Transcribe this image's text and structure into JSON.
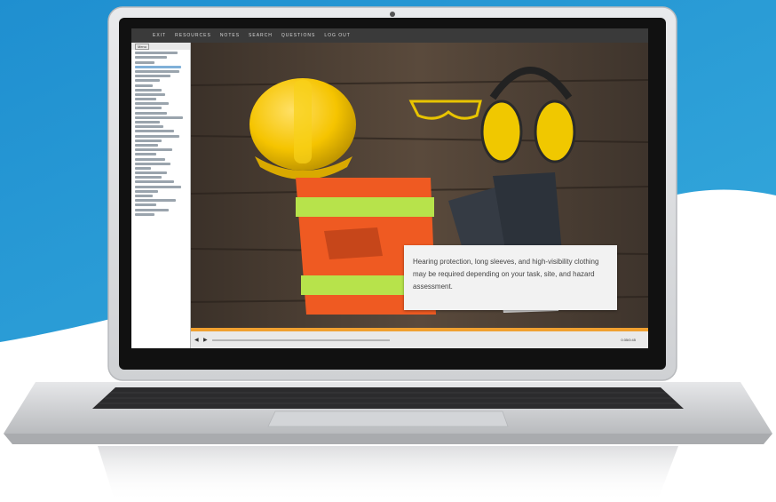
{
  "menu": {
    "items": [
      "EXIT",
      "RESOURCES",
      "NOTES",
      "SEARCH",
      "QUESTIONS",
      "LOG OUT"
    ]
  },
  "sidebar": {
    "tab_label": "Menu"
  },
  "slide": {
    "caption": "Hearing protection, long sleeves, and high-visibility clothing may be required depending on your task, site, and hazard assessment."
  },
  "player": {
    "time": "0:35/0:45"
  },
  "colors": {
    "background_blue": "#2a9bd6",
    "progress_orange": "#f0a030",
    "menubar": "#3a3a3a"
  }
}
